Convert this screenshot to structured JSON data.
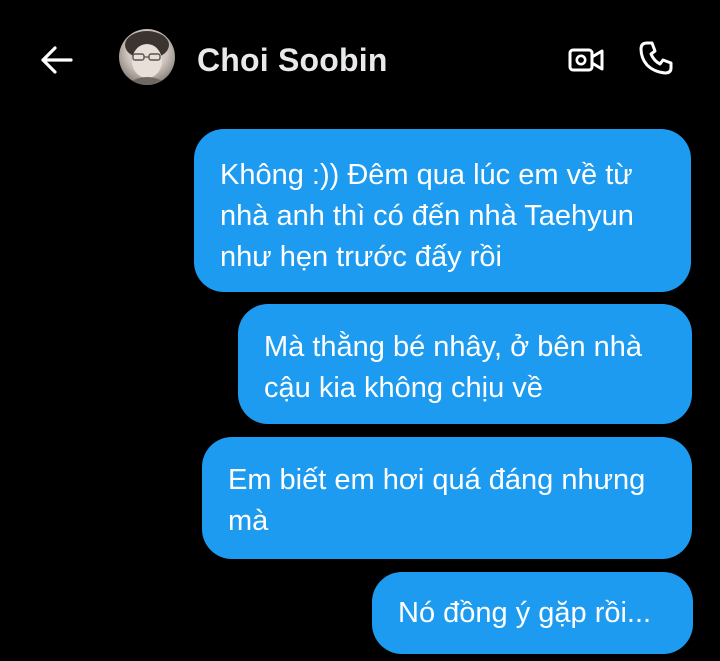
{
  "header": {
    "contact_name": "Choi Soobin",
    "back_icon": "arrow-left-icon",
    "video_icon": "video-camera-icon",
    "call_icon": "phone-icon"
  },
  "colors": {
    "background": "#000000",
    "bubble": "#1d9bf0",
    "text": "#ffffff",
    "name": "#e7e9ea"
  },
  "messages": [
    {
      "direction": "outgoing",
      "text": "Không :)) Đêm qua lúc em về từ\nnhà anh thì có đến nhà Taehyun\nnhư hẹn trước đấy rồi"
    },
    {
      "direction": "outgoing",
      "text": "Mà thằng bé nhây, ở bên nhà\ncậu kia không chịu về"
    },
    {
      "direction": "outgoing",
      "text": "Em biết em hơi quá đáng nhưng\nmà"
    },
    {
      "direction": "outgoing",
      "text": "Nó đồng ý gặp rồi..."
    }
  ]
}
